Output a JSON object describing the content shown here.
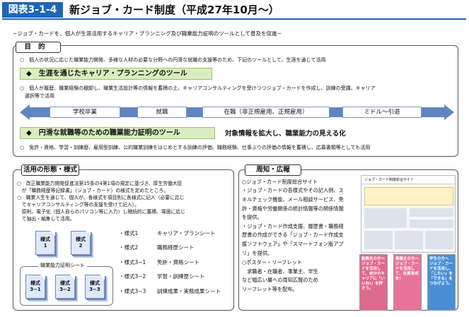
{
  "header": {
    "badge": "図表3-1-4",
    "title": "新ジョブ・カード制度（平成27年10月〜）"
  },
  "intro": "−ジョブ・カードを、個人が生涯活用するキャリア・プランニング及び職業能力証明のツールとして普及を促進−",
  "purpose": {
    "label": "目的",
    "line1": "○　個人の状況に応じた職業能力開発、多様な人材の必要な分野への円滑な就職の支援等のため、下記のツールとして、生涯を通じて活用",
    "bar1": "◆　生涯を通じたキャリア・プランニングのツール",
    "line2": "○　個人が履歴、職業経験の棚卸し、職業生活設計等の情報を蓄積の上、キャリアコンサルティングを受けつつジョブ・カードを作成し、訓練の受講、キャリア",
    "line3": "　選択等で活用",
    "stages": [
      "学校卒業",
      "就職",
      "在職（非正規雇用、正規雇用）",
      "ミドル〜引退"
    ],
    "bar2": "◆　円滑な就職等のための職業能力証明のツール",
    "bar2_right": "対象情報を拡大し、職業能力の見える化",
    "line4": "○　免許・資格、学習・訓練歴、雇用型訓練、公的職業訓練をはじめとする訓練の評価、職務経験、仕事ぶりの評価の情報を蓄積し、応募書類等としても活用"
  },
  "usage": {
    "label": "活用の形態・様式",
    "lines": [
      "○　改正職業能力開発促進法第15条の4第1項の規定に基づき、厚生労働大臣",
      "　が「職務経歴等記録書」（ジョブ・カード）の様式を定めたところ。",
      "○　職業人生を通じて、個人が、各様式を項目別に各様式に記入（必要に応じ",
      "　てキャリアコンサルティング等の支援を受けて記入）。",
      "　原則、電子化（個人自らのパソコン等に入力）し継続的に蓄積、場面に応じ",
      "　て抽出・編集して活用。"
    ],
    "doc1": "様式\n1",
    "doc2": "様式\n2",
    "cert_label": "職業能力証明シート",
    "doc31": "様式\n3−1",
    "doc32": "様式\n3−2",
    "doc33": "様式\n3−3",
    "forms": [
      {
        "no": "・様式1",
        "name": "キャリア・プランシート"
      },
      {
        "no": "・様式2",
        "name": "職務経歴シート"
      },
      {
        "no": "・様式3−1",
        "name": "免許・資格シート"
      },
      {
        "no": "・様式3−2",
        "name": "学習・訓練歴シート"
      },
      {
        "no": "・様式3−3",
        "name": "訓練成果・実務成果シート"
      }
    ]
  },
  "pub": {
    "label": "周知・広報",
    "lines": [
      "○ジョブ・カード制度総合サイト",
      "・ジョブ・カードの各様式やその記入例、ス",
      "キルチェック機能、メール相談サービス、免",
      "許・資格や労働関係の統計情報等の関係情報",
      "を提供。",
      "・ジョブ・カード作成支援、履歴書・職務経",
      "歴書の作成ができる「ジョブ・カード作成支",
      "援ソフトウェア」や「スマートフォン版アプ",
      "リ」を提供。",
      "○ポスター・リーフレット",
      "　求職者・在職者、事業主、学生",
      "など幅広い層への周知広報のため",
      "リーフレット等を配布。"
    ],
    "site_title": "ジョブ・カード制度総合サイト",
    "leaflet1": "勤務先の方へ ジョブ・カードを活用して、自分のキャリアに「いいね!」を押そう。",
    "leaflet2": "事業主の方へ ジョブ・カードを活用して、社員育成を!",
    "leaflet3": "学生の方へ ジョブ・カードを活用し、「したい」を「できる」をつなげよう。"
  },
  "colors": {
    "accent": "#1e66b5",
    "bar": "#d9eec0",
    "arrow": "#5f86c2"
  }
}
